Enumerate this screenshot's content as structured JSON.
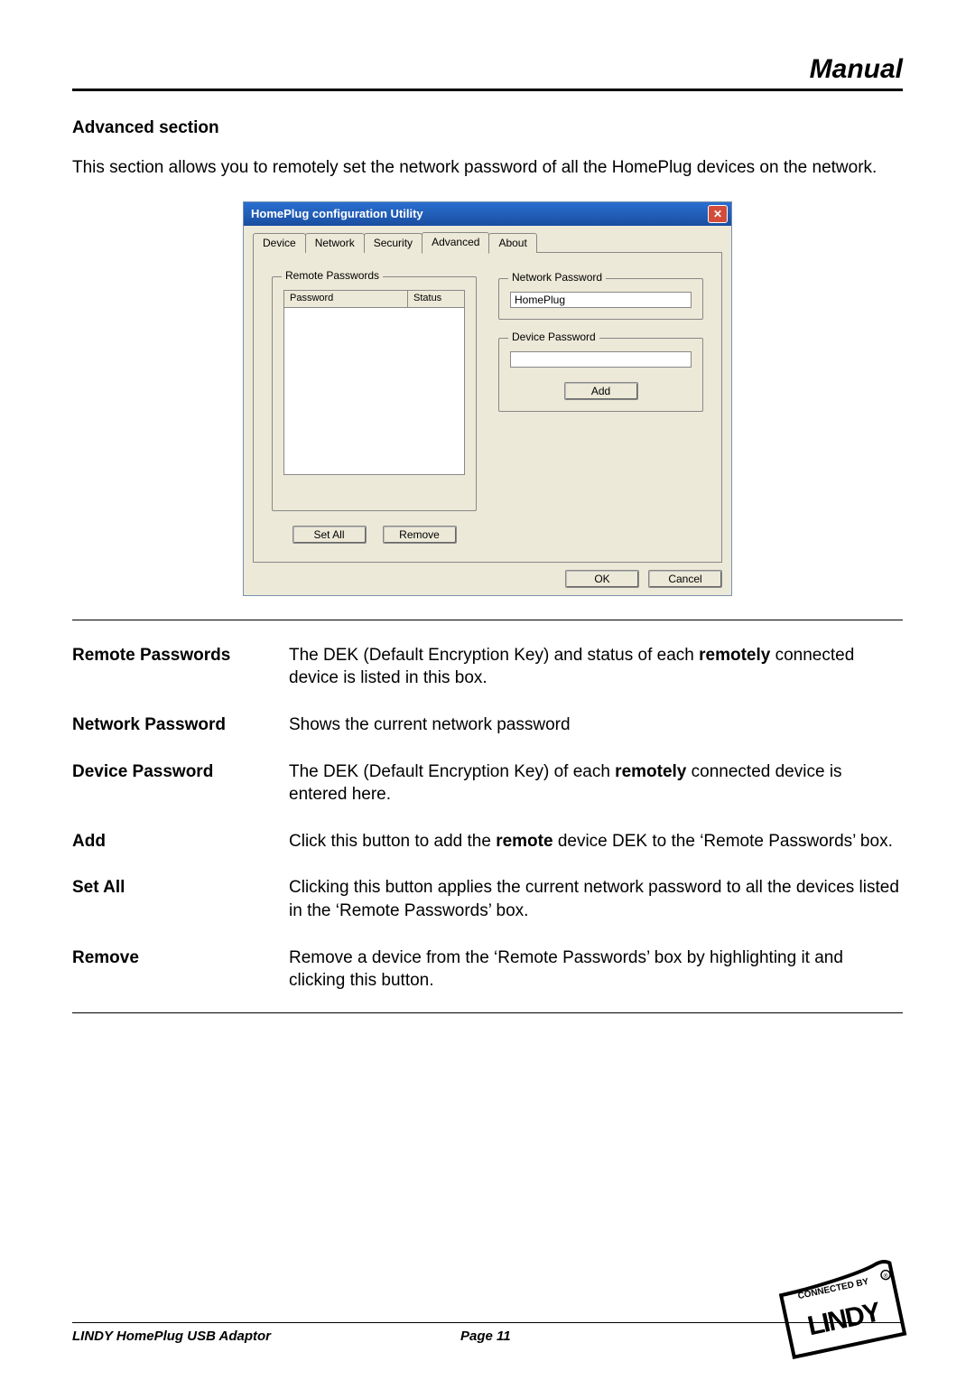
{
  "header": {
    "title": "Manual"
  },
  "section_heading": "Advanced section",
  "intro_text": "This section allows you to remotely set the network password of all the HomePlug devices on the network.",
  "dialog": {
    "title": "HomePlug configuration Utility",
    "tabs": [
      "Device",
      "Network",
      "Security",
      "Advanced",
      "About"
    ],
    "active_tab_index": 3,
    "remote_passwords_label": "Remote Passwords",
    "col_password": "Password",
    "col_status": "Status",
    "set_all_btn": "Set All",
    "remove_btn": "Remove",
    "network_password_label": "Network Password",
    "network_password_value": "HomePlug",
    "device_password_label": "Device Password",
    "device_password_value": "",
    "add_btn": "Add",
    "ok_btn": "OK",
    "cancel_btn": "Cancel"
  },
  "definitions": [
    {
      "term": "Remote Passwords",
      "pre": "The DEK (Default Encryption Key) and status of each ",
      "bold": "remotely",
      "post": " connected device is listed in this box."
    },
    {
      "term": "Network Password",
      "pre": "Shows the current network password",
      "bold": "",
      "post": ""
    },
    {
      "term": "Device Password",
      "pre": "The DEK (Default Encryption Key) of each ",
      "bold": "remotely",
      "post": " connected device is entered here."
    },
    {
      "term": "Add",
      "pre": "Click this button to add the ",
      "bold": "remote",
      "post": " device DEK to the ‘Remote Passwords’ box."
    },
    {
      "term": "Set All",
      "pre": "Clicking this button applies the current network password to all the devices listed in the ‘Remote Passwords’ box.",
      "bold": "",
      "post": ""
    },
    {
      "term": "Remove",
      "pre": "Remove a device from the ‘Remote Passwords’ box by highlighting it and clicking this button.",
      "bold": "",
      "post": ""
    }
  ],
  "footer": {
    "product": "LINDY HomePlug USB Adaptor",
    "page": "Page 11",
    "logo_top": "CONNECTED BY",
    "logo_main": "LINDY"
  }
}
